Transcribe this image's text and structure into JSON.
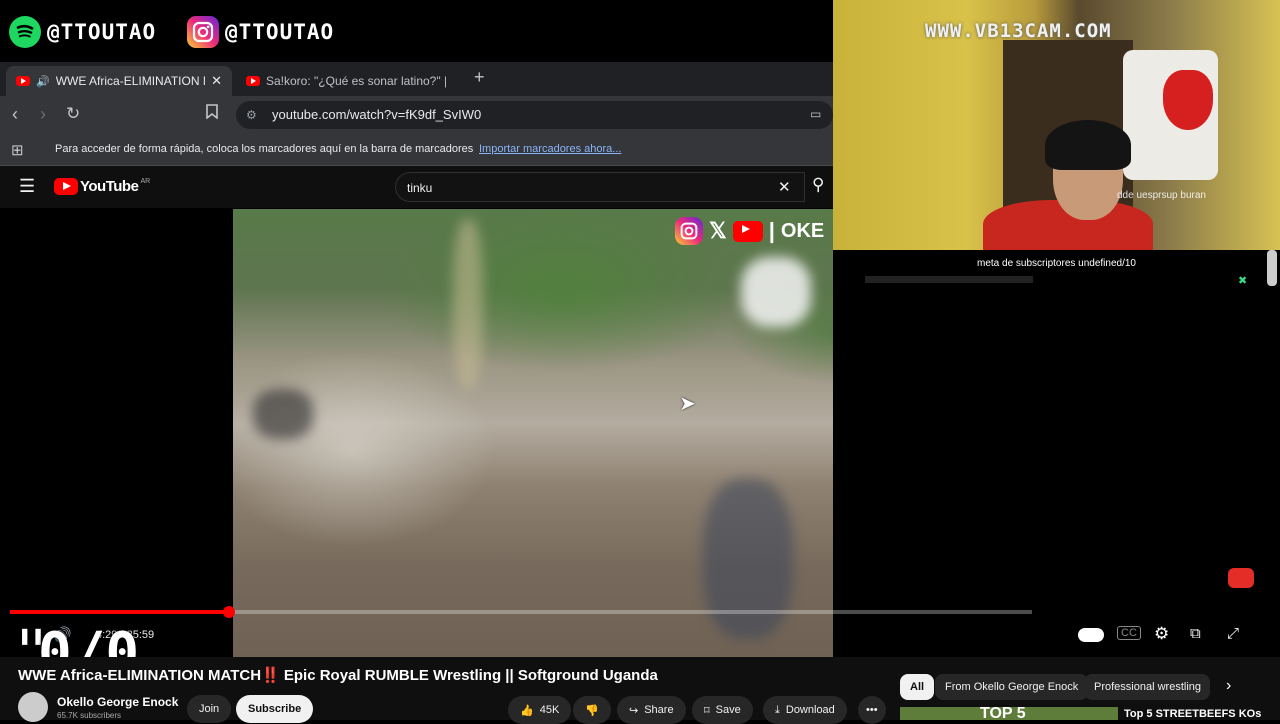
{
  "social": {
    "spotify_handle": "@TTOUTAO",
    "instagram_handle": "@TTOUTAO"
  },
  "browser": {
    "tabs": [
      {
        "title": "WWE Africa-ELIMINATION M",
        "active": true
      },
      {
        "title": "Sa!koro: \"¿Qué es sonar latino?\" | Ent",
        "active": false
      }
    ],
    "url": "youtube.com/watch?v=fK9df_SvIW0",
    "bookmarks_text": "Para acceder de forma rápida, coloca los marcadores aquí en la barra de marcadores",
    "bookmarks_link": "Importar marcadores ahora..."
  },
  "youtube": {
    "logo_text": "YouTube",
    "logo_sup": "AR",
    "search_value": "tinku"
  },
  "video": {
    "watermark_text": "OKE",
    "time": "4:29 / 25:59",
    "progress_fraction": 0.214,
    "title": "WWE Africa-ELIMINATION MATCH‼️ Epic Royal RUMBLE Wrestling || Softground Uganda"
  },
  "overlay": {
    "counter": "0/0"
  },
  "channel": {
    "name": "Okello George Enock",
    "subscribers": "65.7K subscribers",
    "join_label": "Join",
    "subscribe_label": "Subscribe"
  },
  "actions": {
    "likes": "45K",
    "share": "Share",
    "save": "Save",
    "download": "Download",
    "more": "•••"
  },
  "chips": [
    "All",
    "From Okello George Enock",
    "Professional wrestling"
  ],
  "recommended": {
    "title": "Top 5 STREETBEEFS KOs",
    "thumb_text": "TOP 5"
  },
  "webcam": {
    "watermark": "WWW.VB13CAM.COM",
    "scroll_text": "dde uesprsup buran",
    "sub_goal": "meta de subscriptores undefined/10"
  },
  "colors": {
    "accent": "#ff0000",
    "spotify": "#1ed760",
    "background": "#0f0f0f"
  }
}
